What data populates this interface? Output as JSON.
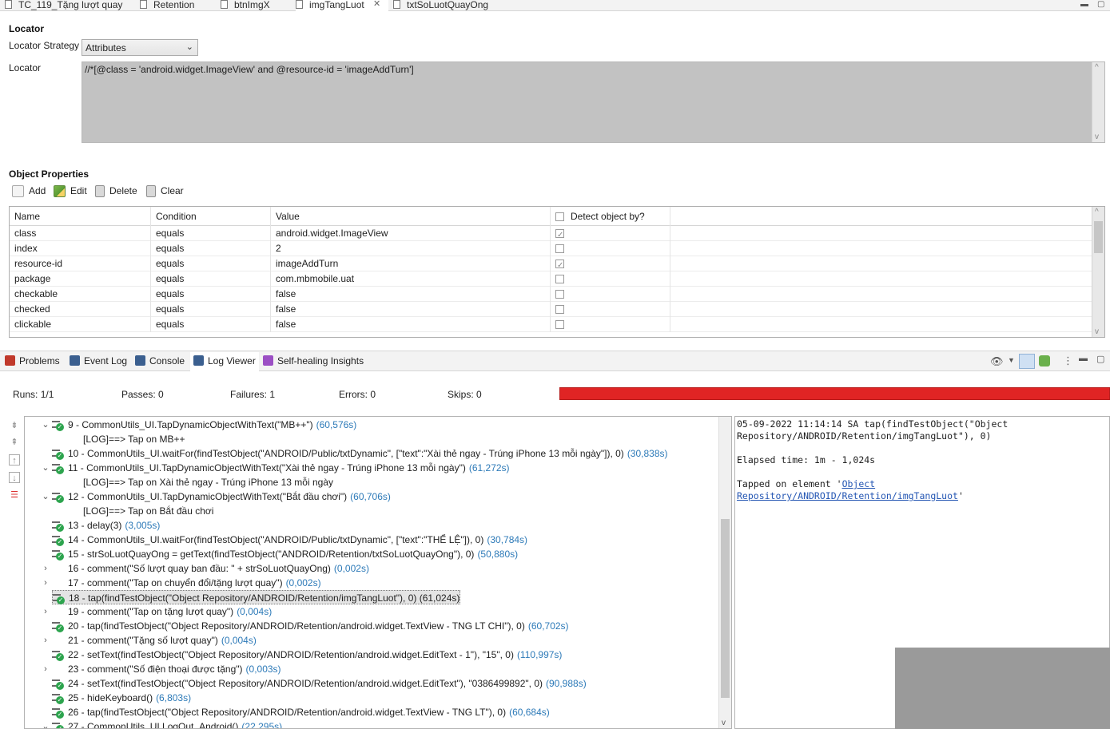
{
  "editor_tabs": [
    {
      "label": "TC_119_Tặng lượt quay",
      "active": false
    },
    {
      "label": "Retention",
      "active": false
    },
    {
      "label": "btnImgX",
      "active": false
    },
    {
      "label": "imgTangLuot",
      "active": true
    },
    {
      "label": "txtSoLuotQuayOng",
      "active": false
    }
  ],
  "locator": {
    "section_title": "Locator",
    "strategy_label": "Locator Strategy",
    "strategy_value": "Attributes",
    "locator_label": "Locator",
    "locator_value": "//*[@class = 'android.widget.ImageView' and @resource-id = 'imageAddTurn']"
  },
  "object_properties": {
    "section_title": "Object Properties",
    "toolbar": {
      "add": "Add",
      "edit": "Edit",
      "delete": "Delete",
      "clear": "Clear"
    },
    "columns": [
      "Name",
      "Condition",
      "Value",
      "Detect object by?"
    ],
    "rows": [
      {
        "name": "class",
        "condition": "equals",
        "value": "android.widget.ImageView",
        "detect": true
      },
      {
        "name": "index",
        "condition": "equals",
        "value": "2",
        "detect": false
      },
      {
        "name": "resource-id",
        "condition": "equals",
        "value": "imageAddTurn",
        "detect": true
      },
      {
        "name": "package",
        "condition": "equals",
        "value": "com.mbmobile.uat",
        "detect": false
      },
      {
        "name": "checkable",
        "condition": "equals",
        "value": "false",
        "detect": false
      },
      {
        "name": "checked",
        "condition": "equals",
        "value": "false",
        "detect": false
      },
      {
        "name": "clickable",
        "condition": "equals",
        "value": "false",
        "detect": false
      }
    ]
  },
  "view_tabs": [
    {
      "label": "Problems",
      "color": "#c0392b"
    },
    {
      "label": "Event Log",
      "color": "#3b5f8f"
    },
    {
      "label": "Console",
      "color": "#3b5f8f"
    },
    {
      "label": "Log Viewer",
      "color": "#3b5f8f"
    },
    {
      "label": "Self-healing Insights",
      "color": "#9b4fc4"
    }
  ],
  "stats": {
    "runs_label": "Runs:",
    "runs": "1/1",
    "passes_label": "Passes:",
    "passes": "0",
    "failures_label": "Failures:",
    "failures": "1",
    "errors_label": "Errors:",
    "errors": "0",
    "skips_label": "Skips:",
    "skips": "0",
    "fail_color": "#e02424"
  },
  "log_rows": [
    {
      "text": "9 - CommonUtils_UI.TapDynamicObjectWithText(\"MB++\")",
      "time": "(60,576s)",
      "twisty": "open",
      "icon": true
    },
    {
      "text": "[LOG]==> Tap on MB++",
      "time": "",
      "twisty": "",
      "icon": false,
      "indent": true
    },
    {
      "text": "10 - CommonUtils_UI.waitFor(findTestObject(\"ANDROID/Public/txtDynamic\", [\"text\":\"Xài thẻ ngay - Trúng iPhone 13 mỗi ngày\"]), 0)",
      "time": "(30,838s)",
      "twisty": "",
      "icon": true
    },
    {
      "text": "11 - CommonUtils_UI.TapDynamicObjectWithText(\"Xài thẻ ngay - Trúng iPhone 13 mỗi ngày\")",
      "time": "(61,272s)",
      "twisty": "open",
      "icon": true
    },
    {
      "text": "[LOG]==> Tap on Xài thẻ ngay - Trúng iPhone 13 mỗi ngày",
      "time": "",
      "twisty": "",
      "icon": false,
      "indent": true
    },
    {
      "text": "12 - CommonUtils_UI.TapDynamicObjectWithText(\"Bắt đầu chơi\")",
      "time": "(60,706s)",
      "twisty": "open",
      "icon": true
    },
    {
      "text": "[LOG]==> Tap on Bắt đầu chơi",
      "time": "",
      "twisty": "",
      "icon": false,
      "indent": true
    },
    {
      "text": "13 - delay(3)",
      "time": "(3,005s)",
      "twisty": "",
      "icon": true
    },
    {
      "text": "14 - CommonUtils_UI.waitFor(findTestObject(\"ANDROID/Public/txtDynamic\", [\"text\":\"THỂ LỆ\"]), 0)",
      "time": "(30,784s)",
      "twisty": "",
      "icon": true
    },
    {
      "text": "15 - strSoLuotQuayOng = getText(findTestObject(\"ANDROID/Retention/txtSoLuotQuayOng\"), 0)",
      "time": "(50,880s)",
      "twisty": "",
      "icon": true
    },
    {
      "text": "16 - comment(\"Số lượt quay ban đầu: \" + strSoLuotQuayOng)",
      "time": "(0,002s)",
      "twisty": "closed",
      "icon": false
    },
    {
      "text": "17 - comment(\"Tap on chuyển đổi/tặng lượt quay\")",
      "time": "(0,002s)",
      "twisty": "closed",
      "icon": false
    },
    {
      "text": "18 - tap(findTestObject(\"Object Repository/ANDROID/Retention/imgTangLuot\"), 0) (61,024s)",
      "time": "",
      "twisty": "",
      "icon": true,
      "selected": true
    },
    {
      "text": "19 - comment(\"Tap on tặng lượt quay\")",
      "time": "(0,004s)",
      "twisty": "closed",
      "icon": false
    },
    {
      "text": "20 - tap(findTestObject(\"Object Repository/ANDROID/Retention/android.widget.TextView - TNG LT CHI\"), 0)",
      "time": "(60,702s)",
      "twisty": "",
      "icon": true
    },
    {
      "text": "21 - comment(\"Tặng số lượt quay\")",
      "time": "(0,004s)",
      "twisty": "closed",
      "icon": false
    },
    {
      "text": "22 - setText(findTestObject(\"Object Repository/ANDROID/Retention/android.widget.EditText - 1\"), \"15\", 0)",
      "time": "(110,997s)",
      "twisty": "",
      "icon": true
    },
    {
      "text": "23 - comment(\"Số điện thoại được tặng\")",
      "time": "(0,003s)",
      "twisty": "closed",
      "icon": false
    },
    {
      "text": "24 - setText(findTestObject(\"Object Repository/ANDROID/Retention/android.widget.EditText\"), \"0386499892\", 0)",
      "time": "(90,988s)",
      "twisty": "",
      "icon": true
    },
    {
      "text": "25 - hideKeyboard()",
      "time": "(6,803s)",
      "twisty": "",
      "icon": true
    },
    {
      "text": "26 - tap(findTestObject(\"Object Repository/ANDROID/Retention/android.widget.TextView - TNG LT\"), 0)",
      "time": "(60,684s)",
      "twisty": "",
      "icon": true
    },
    {
      "text": "27 - CommonUtils_UI.LogOut_Android()",
      "time": "(22,295s)",
      "twisty": "open",
      "icon": true
    }
  ],
  "detail": {
    "line1": "05-09-2022 11:14:14 SA tap(findTestObject(\"Object",
    "line2": "Repository/ANDROID/Retention/imgTangLuot\"), 0)",
    "elapsed": "Elapsed time: 1m - 1,024s",
    "tapped_prefix": "Tapped on element '",
    "link1": "Object ",
    "link2": "Repository/ANDROID/Retention/imgTangLuot",
    "tapped_suffix": "'"
  }
}
